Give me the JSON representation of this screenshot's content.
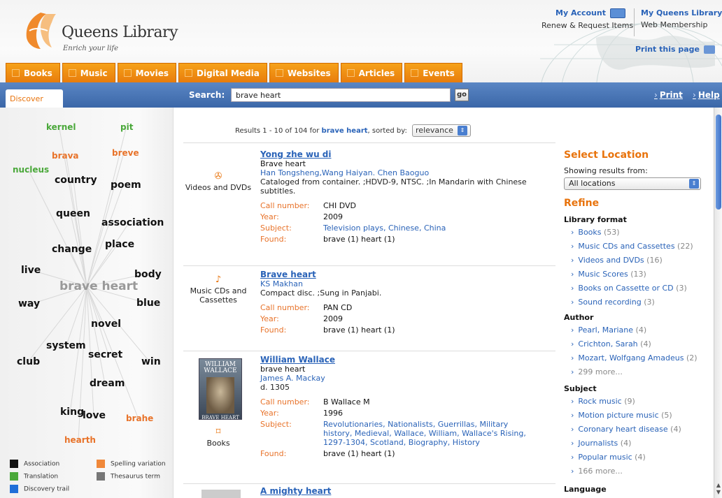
{
  "header": {
    "logo_name": "Queens Library",
    "logo_tagline": "Enrich your life",
    "my_account": "My Account",
    "renew_request": "Renew & Request Items",
    "my_queens_library": "My Queens Library",
    "web_membership": "Web Membership",
    "print_this_page": "Print this page"
  },
  "tabs": [
    "Books",
    "Music",
    "Movies",
    "Digital Media",
    "Websites",
    "Articles",
    "Events"
  ],
  "searchbar": {
    "discover_tab": "Discover",
    "search_label": "Search:",
    "query": "brave heart",
    "go_label": "go",
    "print_label": "Print",
    "help_label": "Help"
  },
  "cloud": {
    "center": "brave heart",
    "words": [
      {
        "text": "kernel",
        "color": "green"
      },
      {
        "text": "pit",
        "color": "green"
      },
      {
        "text": "brava",
        "color": "orange"
      },
      {
        "text": "breve",
        "color": "orange"
      },
      {
        "text": "nucleus",
        "color": "green"
      },
      {
        "text": "country",
        "color": "black"
      },
      {
        "text": "poem",
        "color": "black"
      },
      {
        "text": "queen",
        "color": "black"
      },
      {
        "text": "association",
        "color": "black"
      },
      {
        "text": "change",
        "color": "black"
      },
      {
        "text": "place",
        "color": "black"
      },
      {
        "text": "live",
        "color": "black"
      },
      {
        "text": "body",
        "color": "black"
      },
      {
        "text": "way",
        "color": "black"
      },
      {
        "text": "blue",
        "color": "black"
      },
      {
        "text": "novel",
        "color": "black"
      },
      {
        "text": "system",
        "color": "black"
      },
      {
        "text": "secret",
        "color": "black"
      },
      {
        "text": "club",
        "color": "black"
      },
      {
        "text": "win",
        "color": "black"
      },
      {
        "text": "dream",
        "color": "black"
      },
      {
        "text": "king",
        "color": "black"
      },
      {
        "text": "love",
        "color": "black"
      },
      {
        "text": "brahe",
        "color": "orange"
      },
      {
        "text": "hearth",
        "color": "orange"
      }
    ],
    "legend": [
      {
        "label": "Association",
        "color": "#111111"
      },
      {
        "label": "Spelling variation",
        "color": "#f0883a"
      },
      {
        "label": "Translation",
        "color": "#4aa83a"
      },
      {
        "label": "Thesaurus term",
        "color": "#777777"
      },
      {
        "label": "Discovery trail",
        "color": "#1f6fd8"
      }
    ]
  },
  "results": {
    "summary_prefix": "Results 1 - 10 of 104 for",
    "summary_query": "brave heart",
    "summary_suffix": ", sorted by:",
    "sort_value": "relevance",
    "records": [
      {
        "format": "Videos and DVDs",
        "title": "Yong zhe wu di",
        "subtitle": "Brave heart",
        "author": "Han Tongsheng,Wang Haiyan. Chen Baoguo",
        "desc": "Cataloged from container. ;HDVD-9, NTSC. ;In Mandarin with Chinese subtitles.",
        "call_number": "CHI DVD",
        "year": "2009",
        "subject": "Television plays, Chinese, China",
        "found": "brave (1) heart (1)"
      },
      {
        "format": "Music CDs and Cassettes",
        "title": "Brave heart",
        "subtitle": "",
        "author": "KS Makhan",
        "desc": "Compact disc. ;Sung in Panjabi.",
        "call_number": "PAN CD",
        "year": "2009",
        "subject": "",
        "found": "brave (1) heart (1)"
      },
      {
        "format": "Books",
        "title": "William Wallace",
        "subtitle": "brave heart",
        "author": "James A. Mackay",
        "desc": "d. 1305",
        "call_number": "B Wallace M",
        "year": "1996",
        "subject": "Revolutionaries, Nationalists, Guerrillas, Military history, Medieval, Wallace, William, Wallace's Rising, 1297-1304, Scotland, Biography, History",
        "found": "brave (1) heart (1)",
        "cover_title": "WILLIAM WALLACE",
        "cover_sub": "BRAVE HEART"
      },
      {
        "format": "",
        "title": "A mighty heart"
      }
    ],
    "labels": {
      "call_number": "Call number:",
      "year": "Year:",
      "subject": "Subject:",
      "found": "Found:"
    }
  },
  "refine": {
    "select_location": "Select Location",
    "showing_from": "Showing results from:",
    "location_value": "All locations",
    "refine_heading": "Refine",
    "library_format": "Library format",
    "format_items": [
      {
        "label": "Books",
        "count": "(53)"
      },
      {
        "label": "Music CDs and Cassettes",
        "count": "(22)"
      },
      {
        "label": "Videos and DVDs",
        "count": "(16)"
      },
      {
        "label": "Music Scores",
        "count": "(13)"
      },
      {
        "label": "Books on Cassette or CD",
        "count": "(3)"
      },
      {
        "label": "Sound recording",
        "count": "(3)"
      }
    ],
    "author": "Author",
    "author_items": [
      {
        "label": "Pearl, Mariane",
        "count": "(4)"
      },
      {
        "label": "Crichton, Sarah",
        "count": "(4)"
      },
      {
        "label": "Mozart, Wolfgang Amadeus",
        "count": "(2)"
      },
      {
        "label": "299 more...",
        "count": ""
      }
    ],
    "subject": "Subject",
    "subject_items": [
      {
        "label": "Rock music",
        "count": "(9)"
      },
      {
        "label": "Motion picture music",
        "count": "(5)"
      },
      {
        "label": "Coronary heart disease",
        "count": "(4)"
      },
      {
        "label": "Journalists",
        "count": "(4)"
      },
      {
        "label": "Popular music",
        "count": "(4)"
      },
      {
        "label": "166 more...",
        "count": ""
      }
    ],
    "language": "Language"
  }
}
